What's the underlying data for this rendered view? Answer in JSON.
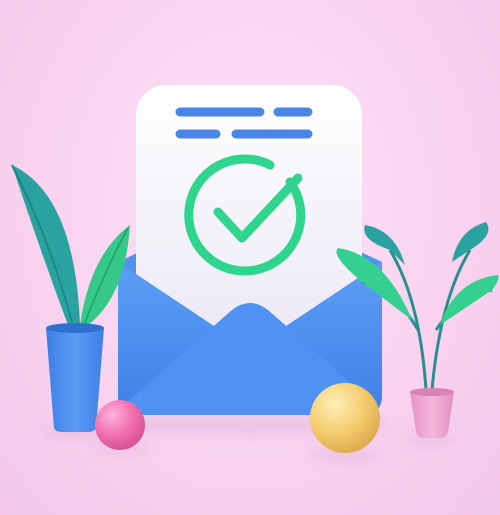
{
  "scene": {
    "icons": {
      "document": "document-icon",
      "checkmark": "checkmark-icon",
      "envelope": "envelope-icon",
      "left_plant": "plant-icon",
      "right_plant": "plant-icon",
      "pink_ball": "ball-icon",
      "yellow_ball": "ball-icon"
    },
    "colors": {
      "background": "#f8d2ef",
      "paper": "#f7f5fb",
      "text_lines": "#4a86e8",
      "check": "#2fd58c",
      "envelope": "#4b8ef0",
      "envelope_dark": "#3f7be0",
      "leaf_teal": "#2aa3a0",
      "leaf_green": "#35d08f",
      "blue_pot": "#4a8ef0",
      "pink_pot": "#f2a8d3",
      "pink_ball": "#f06fb0",
      "yellow_ball": "#f4cd6f"
    }
  }
}
